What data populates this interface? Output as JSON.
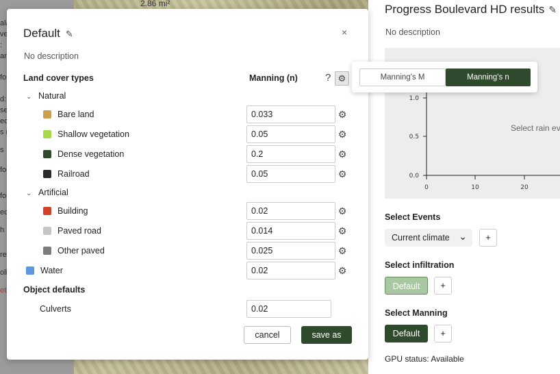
{
  "background": {
    "area_label": "2.86 mi²",
    "left_fragments": [
      "ala",
      "vec",
      ":",
      "arp",
      "for",
      "d:",
      "se",
      "edit",
      "s r",
      "s",
      "for",
      "for",
      "ec",
      "h",
      "re",
      "olic",
      "ete"
    ]
  },
  "right_panel": {
    "title": "Progress Boulevard HD results",
    "description": "No description",
    "chart": {
      "message": "Select rain ev",
      "y_ticks": [
        "1.0",
        "0.5",
        "0.0"
      ],
      "x_ticks": [
        "0",
        "10",
        "20"
      ]
    },
    "select_events": {
      "label": "Select Events",
      "dropdown_value": "Current climate",
      "add": "+"
    },
    "select_infiltration": {
      "label": "Select infiltration",
      "button": "Default",
      "add": "+"
    },
    "select_manning": {
      "label": "Select Manning",
      "button": "Default",
      "add": "+"
    },
    "gpu_status": "GPU status: Available"
  },
  "modal": {
    "title": "Default",
    "close": "×",
    "description": "No description",
    "header_land_cover": "Land cover types",
    "header_manning": "Manning (n)",
    "help": "?",
    "groups": [
      {
        "name": "Natural",
        "items": [
          {
            "label": "Bare land",
            "value": "0.033",
            "color": "#c9a052"
          },
          {
            "label": "Shallow vegetation",
            "value": "0.05",
            "color": "#a8d84a"
          },
          {
            "label": "Dense vegetation",
            "value": "0.2",
            "color": "#2e4a2a"
          },
          {
            "label": "Railroad",
            "value": "0.05",
            "color": "#2b2b2b"
          }
        ]
      },
      {
        "name": "Artificial",
        "items": [
          {
            "label": "Building",
            "value": "0.02",
            "color": "#d2432a"
          },
          {
            "label": "Paved road",
            "value": "0.014",
            "color": "#c6c6c6"
          },
          {
            "label": "Other paved",
            "value": "0.025",
            "color": "#7d7d7d"
          }
        ]
      }
    ],
    "water": {
      "label": "Water",
      "value": "0.02",
      "color": "#5c95e6"
    },
    "object_defaults": "Object defaults",
    "culverts": {
      "label": "Culverts",
      "value": "0.02"
    },
    "cancel": "cancel",
    "save_as": "save as"
  },
  "popover": {
    "option_m": "Manning's M",
    "option_n": "Manning's n"
  },
  "colors": {
    "accent": "#2f4a2c",
    "accent_light": "#a9c7a2"
  }
}
